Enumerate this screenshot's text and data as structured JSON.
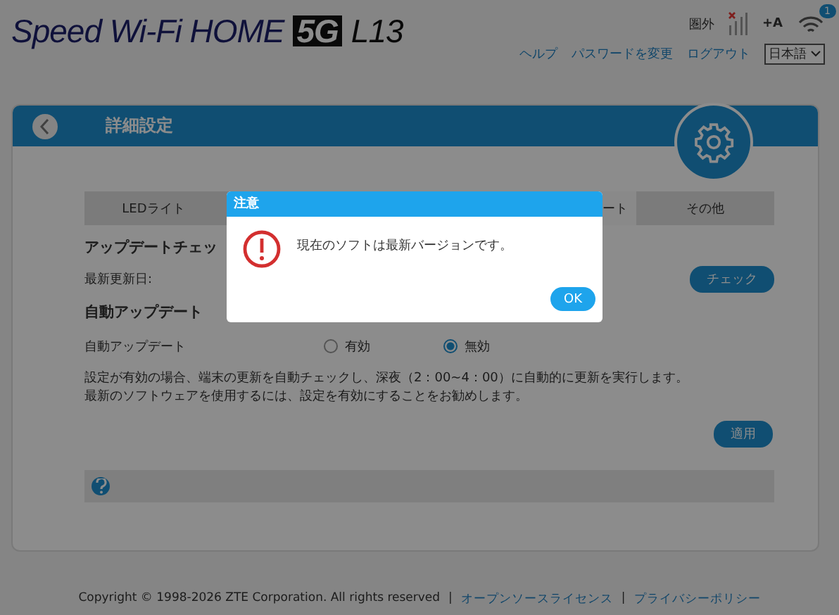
{
  "header": {
    "logo": "Speed Wi-Fi HOME",
    "logo_badge": "5G",
    "logo_model": "L13",
    "status": "圏外",
    "font_size_label": "+A",
    "wifi_count": "1",
    "links": [
      "ヘルプ",
      "パスワードを変更",
      "ログアウト"
    ],
    "language": "日本語"
  },
  "panel": {
    "title": "詳細設定",
    "tabs": [
      {
        "label": "LEDライト",
        "selected": false
      },
      {
        "label": "ート",
        "selected": true
      },
      {
        "label": "その他",
        "selected": false
      }
    ],
    "update_check": {
      "heading": "アップデートチェッ",
      "date_label": "最新更新日:",
      "button": "チェック"
    },
    "auto_update": {
      "heading": "自動アップデート",
      "label": "自動アップデート",
      "options": [
        {
          "label": "有効",
          "selected": false
        },
        {
          "label": "無効",
          "selected": true
        }
      ],
      "note": [
        "設定が有効の場合、端末の更新を自動チェックし、深夜（2：00~4：00）に自動的に更新を実行します。",
        "最新のソフトウェアを使用するには、設定を有効にすることをお勧めします。"
      ],
      "button": "適用"
    }
  },
  "footer": {
    "copyright": "Copyright © 1998-2026 ZTE Corporation. All rights reserved",
    "links": [
      {
        "separator": "|",
        "label": "オープンソースライセンス"
      },
      {
        "separator": "|",
        "label": "プライバシーポリシー"
      }
    ]
  },
  "dialog": {
    "title": "注意",
    "message": "現在のソフトは最新バージョンです。",
    "button": "OK"
  }
}
